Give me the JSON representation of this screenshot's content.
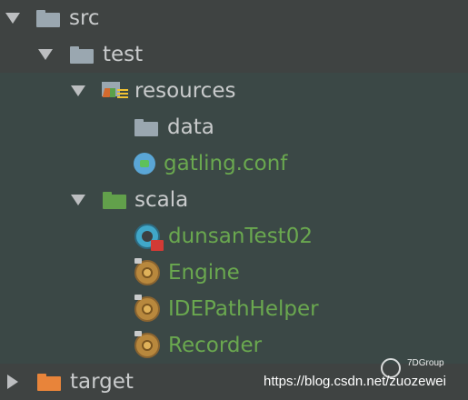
{
  "tree": {
    "nodes": [
      {
        "label": "src",
        "expanded": true,
        "icon": "folder-icon"
      },
      {
        "label": "test",
        "expanded": true,
        "icon": "folder-icon"
      },
      {
        "label": "resources",
        "expanded": true,
        "icon": "resources-folder-icon"
      },
      {
        "label": "data",
        "icon": "folder-icon"
      },
      {
        "label": "gatling.conf",
        "icon": "config-file-icon"
      },
      {
        "label": "scala",
        "expanded": true,
        "icon": "source-folder-icon"
      },
      {
        "label": "dunsanTest02",
        "icon": "scala-object-error-icon"
      },
      {
        "label": "Engine",
        "icon": "scala-class-icon"
      },
      {
        "label": "IDEPathHelper",
        "icon": "scala-class-icon"
      },
      {
        "label": "Recorder",
        "icon": "scala-class-icon"
      },
      {
        "label": "target",
        "expanded": false,
        "icon": "excluded-folder-icon"
      }
    ]
  },
  "watermark": {
    "text": "https://blog.csdn.net/zuozewei",
    "tag": "7DGroup"
  },
  "colors": {
    "background": "#3c3f41",
    "folder": "#9aa7b0",
    "source_folder": "#62a04b",
    "excluded_folder": "#e8843a",
    "green_text": "#6aa84f",
    "default_text": "#c9cbcc"
  }
}
